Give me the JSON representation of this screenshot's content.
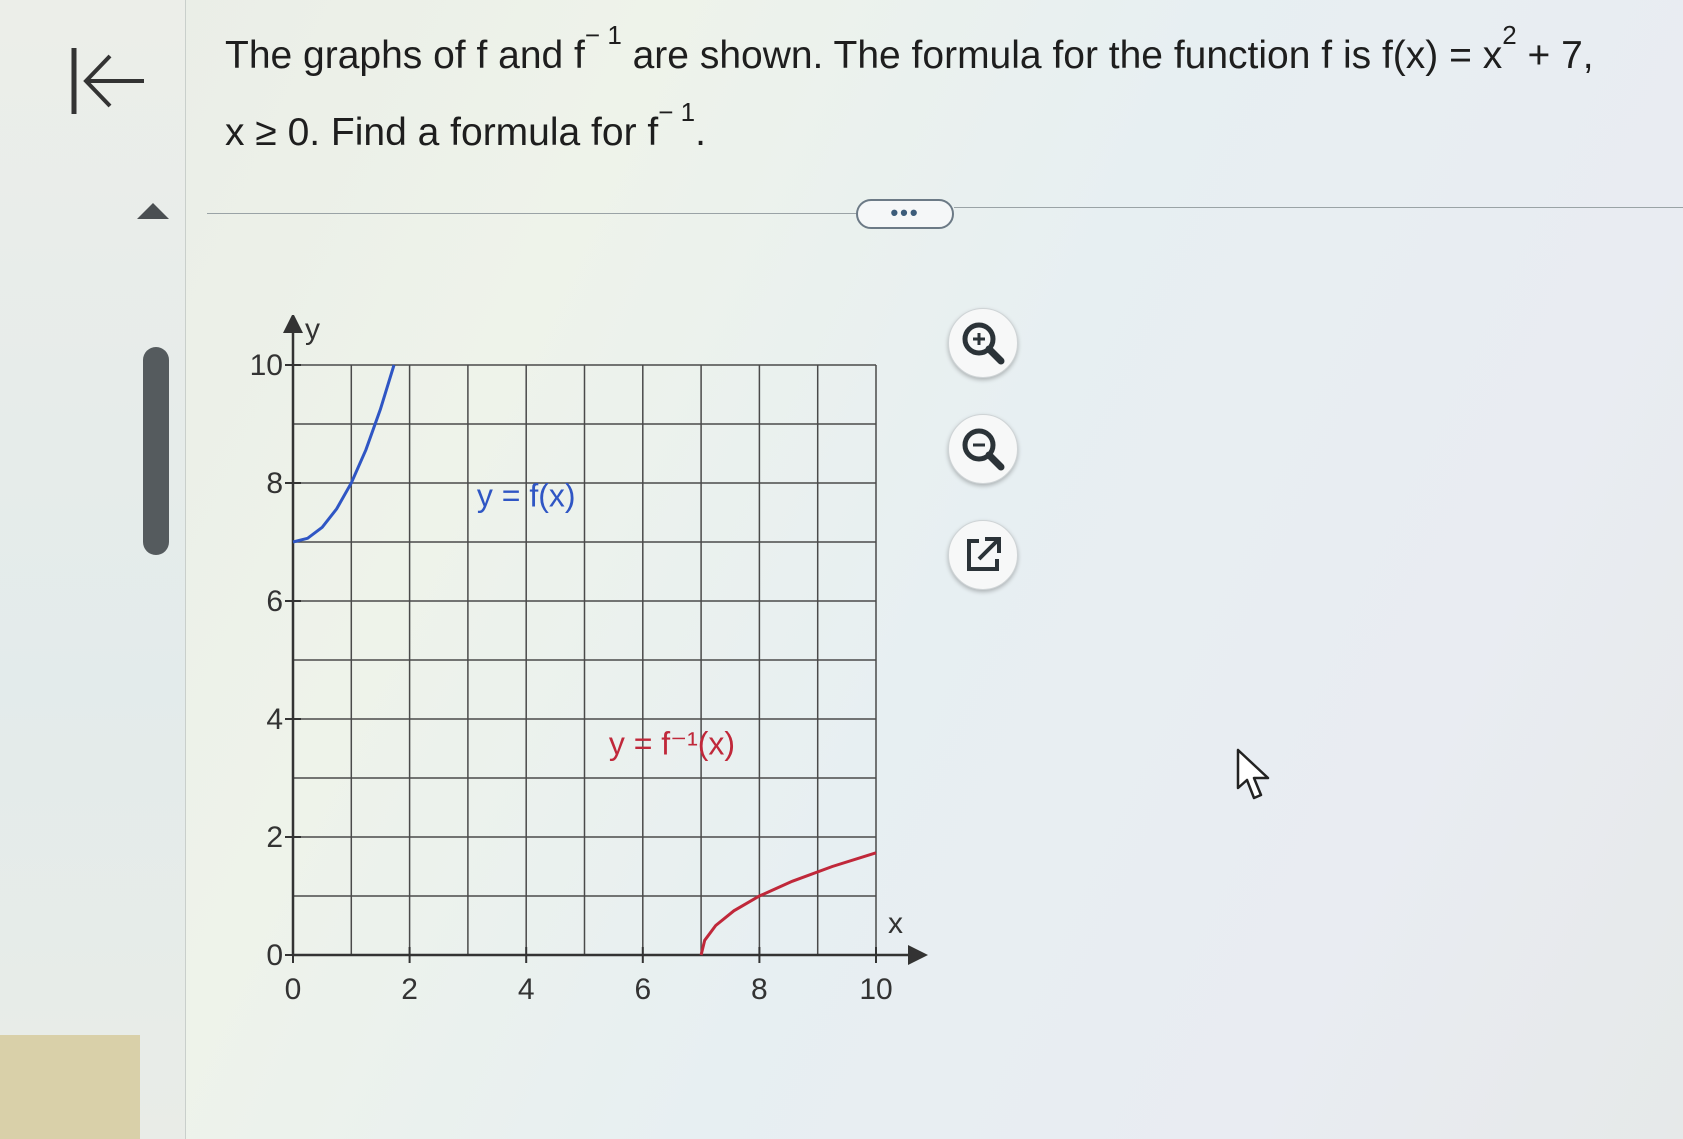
{
  "question": {
    "part1": "The graphs of f and f",
    "sup1": "− 1",
    "part2": " are shown. The formula for the function f is f(x) = x",
    "sup2": "2",
    "part3": " + 7,",
    "line2": "x ≥ 0. Find a formula for f",
    "sup3": "− 1",
    "end": "."
  },
  "more_button": "•••",
  "icons": {
    "back": "back-to-start-icon",
    "collapse": "triangle-up-icon",
    "zoom_in": "zoom-in-icon",
    "zoom_out": "zoom-out-icon",
    "open_new": "open-in-new-window-icon",
    "cursor": "mouse-pointer-icon"
  },
  "colors": {
    "f_curve": "#2f56c4",
    "finv_curve": "#c0283a",
    "grid": "#4a4a4a"
  },
  "chart_data": {
    "type": "line",
    "xlabel": "x",
    "ylabel": "y",
    "xlim": [
      0,
      10
    ],
    "ylim": [
      0,
      10
    ],
    "grid": true,
    "x_ticks": [
      "0",
      "2",
      "4",
      "6",
      "8",
      "10"
    ],
    "y_ticks": [
      "0",
      "2",
      "4",
      "6",
      "8",
      "10"
    ],
    "series": [
      {
        "name": "y = f(x)",
        "color": "#2f56c4",
        "x": [
          0,
          0.25,
          0.5,
          0.75,
          1,
          1.25,
          1.5,
          1.732
        ],
        "y": [
          7,
          7.0625,
          7.25,
          7.5625,
          8,
          8.5625,
          9.25,
          10
        ]
      },
      {
        "name": "y = f⁻¹(x)",
        "color": "#c0283a",
        "x": [
          7,
          7.0625,
          7.25,
          7.5625,
          8,
          8.5625,
          9.25,
          10
        ],
        "y": [
          0,
          0.25,
          0.5,
          0.75,
          1,
          1.25,
          1.5,
          1.732
        ]
      }
    ]
  }
}
